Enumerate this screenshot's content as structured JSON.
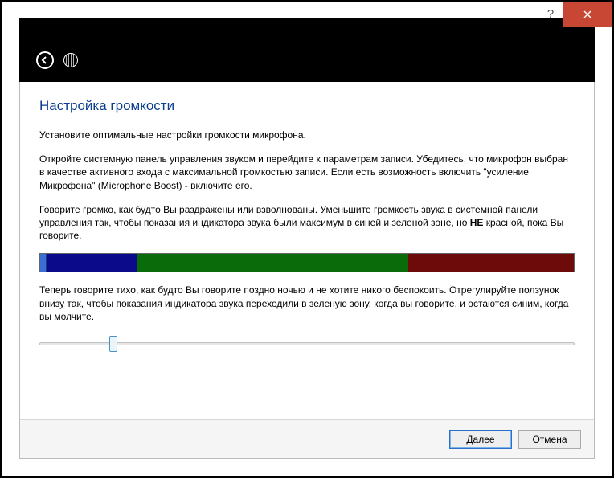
{
  "titlebar": {
    "help_symbol": "?",
    "close_label": "Close"
  },
  "nav": {
    "back_label": "Back",
    "app_icon_label": "Microphone setup"
  },
  "page": {
    "title": "Настройка громкости",
    "p1": "Установите оптимальные настройки громкости микрофона.",
    "p2": "Откройте системную панель управления звуком и перейдите к параметрам записи. Убедитесь, что микрофон выбран в качестве активного входа с максимальной громкостью записи. Если есть возможность включить \"усиление Микрофона\" (Microphone Boost) - включите его.",
    "p3_a": "Говорите громко, как будто Вы раздражены или взволнованы. Уменьшите громкость звука в системной панели управления так, чтобы показания индикатора звука были максимум в синей и зеленой зоне, но ",
    "p3_bold": "НЕ",
    "p3_b": " красной, пока Вы говорите.",
    "p4": "Теперь говорите тихо, как будто Вы говорите поздно ночью и не хотите никого беспокоить. Отрегулируйте ползунок внизу так, чтобы показания индикатора звука переходили в зеленую зону, когда вы говорите, и остаются синим, когда вы молчите."
  },
  "meter": {
    "cursor_pct": 1.2,
    "blue_pct": 17,
    "green_pct": 50.8,
    "red_pct": 31
  },
  "slider": {
    "value_pct": 13
  },
  "footer": {
    "next_underline": "Д",
    "next_rest": "алее",
    "cancel": "Отмена"
  }
}
